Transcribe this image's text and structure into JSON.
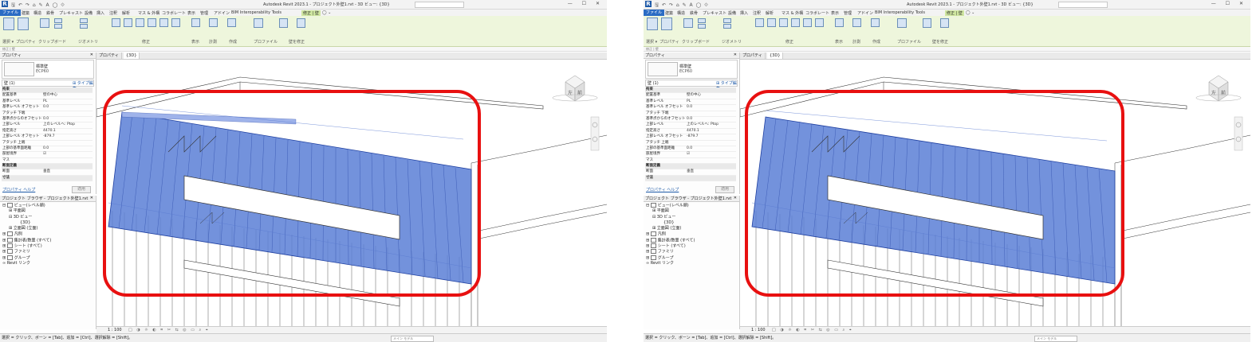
{
  "app": {
    "title": "Autodesk Revit 2023.1 - プロジェクト外壁1.rvt - 3D ビュー: {3D}",
    "logo": "R",
    "qat_icons": "🖫 ↶ ↷ ⌂ ✎ A ◯ ⟐",
    "window_buttons": "— ☐ ✕"
  },
  "ribbon": {
    "tabs": [
      "ファイル",
      "建築",
      "構造",
      "鉄骨",
      "プレキャスト",
      "設備",
      "挿入",
      "注釈",
      "解析",
      "マス & 外構",
      "コラボレート",
      "表示",
      "管理",
      "アドイン",
      "BIM Interoperability Tools",
      "修正 | 壁",
      "◯ ⌄"
    ],
    "panels": [
      "選択 ▾",
      "プロパティ",
      "クリップボード",
      "ジオメトリ",
      "修正",
      "表示",
      "計測",
      "作成",
      "プロファイル",
      "壁を修正"
    ],
    "buttons": [
      "修正",
      "編集",
      "アタッチ上/下部",
      "デタッチ上/下部"
    ]
  },
  "option_bar": "修正 | 壁",
  "properties": {
    "header": "プロパティ",
    "close": "✕",
    "type_name": "標準壁",
    "type_sub": "ECP60",
    "selector": "壁 (1)",
    "edit_type": "⊞ タイプ編集",
    "rows": [
      {
        "k": "拘束",
        "v": "",
        "group": true
      },
      {
        "k": "配置基準",
        "v": "壁の中心"
      },
      {
        "k": "基準レベル",
        "v": "PL"
      },
      {
        "k": "基準レベル オフセット",
        "v": "0.0"
      },
      {
        "k": "アタッチ 下端",
        "v": ""
      },
      {
        "k": "基準点からのオフセット",
        "v": "0.0"
      },
      {
        "k": "上部レベル",
        "v": "上のレベルへ: Ptop"
      },
      {
        "k": "指定高さ",
        "v": "4470.1"
      },
      {
        "k": "上部レベル オフセット",
        "v": "-879.7"
      },
      {
        "k": "アタッチ 上端",
        "v": ""
      },
      {
        "k": "上部の基準面距離",
        "v": "0.0"
      },
      {
        "k": "部屋境界",
        "v": "☑"
      },
      {
        "k": "マス",
        "v": ""
      },
      {
        "k": "断面定義",
        "v": "",
        "group": true
      },
      {
        "k": "断面",
        "v": "垂直"
      },
      {
        "k": "寸法",
        "v": "",
        "group": true
      }
    ],
    "help": "プロパティ ヘルプ",
    "apply": "適用"
  },
  "project_browser": {
    "header": "プロジェクト ブラウザ - プロジェクト外壁1.rvt",
    "close": "✕",
    "items": [
      {
        "label": "ビュー(レベル順)",
        "indent": 0,
        "prefix": "⊟"
      },
      {
        "label": "平面図",
        "indent": 1,
        "prefix": "⊞"
      },
      {
        "label": "3D ビュー",
        "indent": 1,
        "prefix": "⊟"
      },
      {
        "label": "{3D}",
        "indent": 2,
        "prefix": ""
      },
      {
        "label": "立面図 (立面)",
        "indent": 1,
        "prefix": "⊞"
      },
      {
        "label": "凡例",
        "indent": 0,
        "prefix": "⊞"
      },
      {
        "label": "集計表/数量 (すべて)",
        "indent": 0,
        "prefix": "⊞"
      },
      {
        "label": "シート (すべて)",
        "indent": 0,
        "prefix": "⊞"
      },
      {
        "label": "ファミリ",
        "indent": 0,
        "prefix": "⊞"
      },
      {
        "label": "グループ",
        "indent": 0,
        "prefix": "⊞"
      },
      {
        "label": "Revit リンク",
        "indent": 0,
        "prefix": "∞"
      }
    ]
  },
  "view_tabs": [
    "プロパティ",
    "{3D}"
  ],
  "view_close": "✕",
  "viewcube": {
    "left": "左",
    "front": "前"
  },
  "view_bar": {
    "scale": "1 : 100",
    "icons": "□ ◑ ☼ ◐ ⌗ ✂ ⇆ ◎ ▭ ⌕ ⌖"
  },
  "status": {
    "message": "選択 = クリック、ボーン = [Tab]、追加 = [Ctrl]、選択解除 = [Shift]。",
    "model": "メイン モデル"
  },
  "highlight": {
    "color": "#e81010"
  },
  "colors": {
    "wall_fill": "#5b7fd6",
    "file_tab": "#2b6cc4",
    "ribbon_context": "#eef6dc"
  }
}
